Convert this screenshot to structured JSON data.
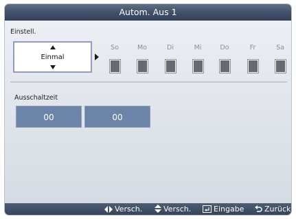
{
  "dialog": {
    "title": "Autom. Aus 1",
    "einstell_label": "Einstell.",
    "repeat_value": "Einmal",
    "days": [
      "So",
      "Mo",
      "Di",
      "Mi",
      "Do",
      "Fr",
      "Sa"
    ],
    "ausschaltzeit_label": "Ausschaltzeit",
    "hour": "00",
    "minute": "00"
  },
  "footer": {
    "hints": [
      {
        "icon": "left-right-arrows-icon",
        "label": "Versch."
      },
      {
        "icon": "up-down-arrows-icon",
        "label": "Versch."
      },
      {
        "icon": "enter-icon",
        "label": "Eingabe"
      },
      {
        "icon": "return-icon",
        "label": "Zurück"
      }
    ]
  }
}
